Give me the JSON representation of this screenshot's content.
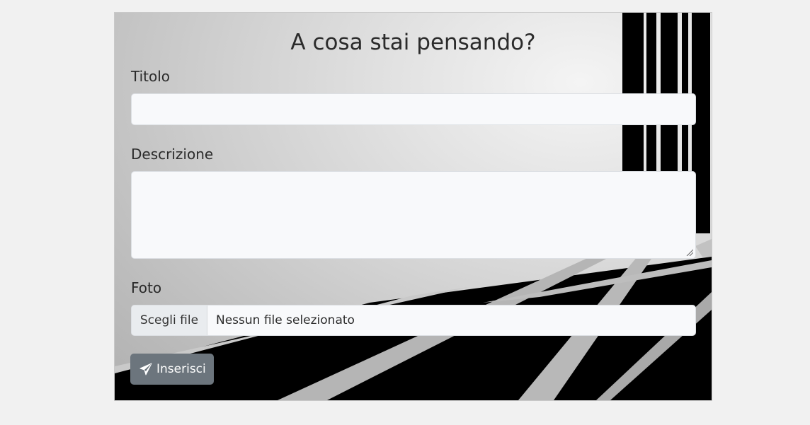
{
  "form": {
    "heading": "A cosa stai pensando?",
    "title_label": "Titolo",
    "title_value": "",
    "description_label": "Descrizione",
    "description_value": "",
    "photo_label": "Foto",
    "file_button_label": "Scegli file",
    "file_status": "Nessun file selezionato",
    "submit_label": "Inserisci",
    "submit_icon": "paper-plane-icon"
  },
  "colors": {
    "page_background": "#f1f1f1",
    "input_background": "#f8f9fb",
    "submit_background": "#6c757d",
    "file_button_background": "#e9ecef"
  }
}
